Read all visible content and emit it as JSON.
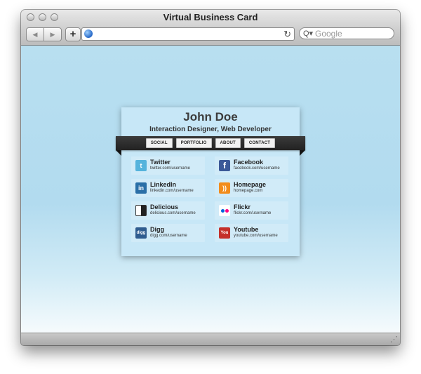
{
  "window": {
    "title": "Virtual Business Card"
  },
  "toolbar": {
    "back_icon": "back-arrow-icon",
    "forward_icon": "forward-arrow-icon",
    "add_label": "+",
    "url_value": "",
    "reload_icon": "reload-icon",
    "search_placeholder": "Google"
  },
  "card": {
    "name": "John Doe",
    "role": "Interaction Designer, Web Developer",
    "menu": [
      "SOCIAL",
      "PORTFOLIO",
      "ABOUT",
      "CONTACT"
    ],
    "social": [
      {
        "name": "Twitter",
        "url": "twitter.com/username",
        "icon": "twitter-icon",
        "color": "#55b3dc"
      },
      {
        "name": "Facebook",
        "url": "facebook.com/username",
        "icon": "facebook-icon",
        "color": "#3b5998"
      },
      {
        "name": "LinkedIn",
        "url": "linkedin.com/username",
        "icon": "linkedin-icon",
        "color": "#2a6fa7"
      },
      {
        "name": "Homepage",
        "url": "homepage.com",
        "icon": "rss-icon",
        "color": "#f28c1c"
      },
      {
        "name": "Delicious",
        "url": "delicious.com/username",
        "icon": "delicious-icon",
        "color": "#222222"
      },
      {
        "name": "Flickr",
        "url": "flickr.com/username",
        "icon": "flickr-icon",
        "color": "#ffffff"
      },
      {
        "name": "Digg",
        "url": "digg.com/username",
        "icon": "digg-icon",
        "color": "#2f5c8f"
      },
      {
        "name": "Youtube",
        "url": "youtube.com/username",
        "icon": "youtube-icon",
        "color": "#c4302b"
      }
    ]
  }
}
